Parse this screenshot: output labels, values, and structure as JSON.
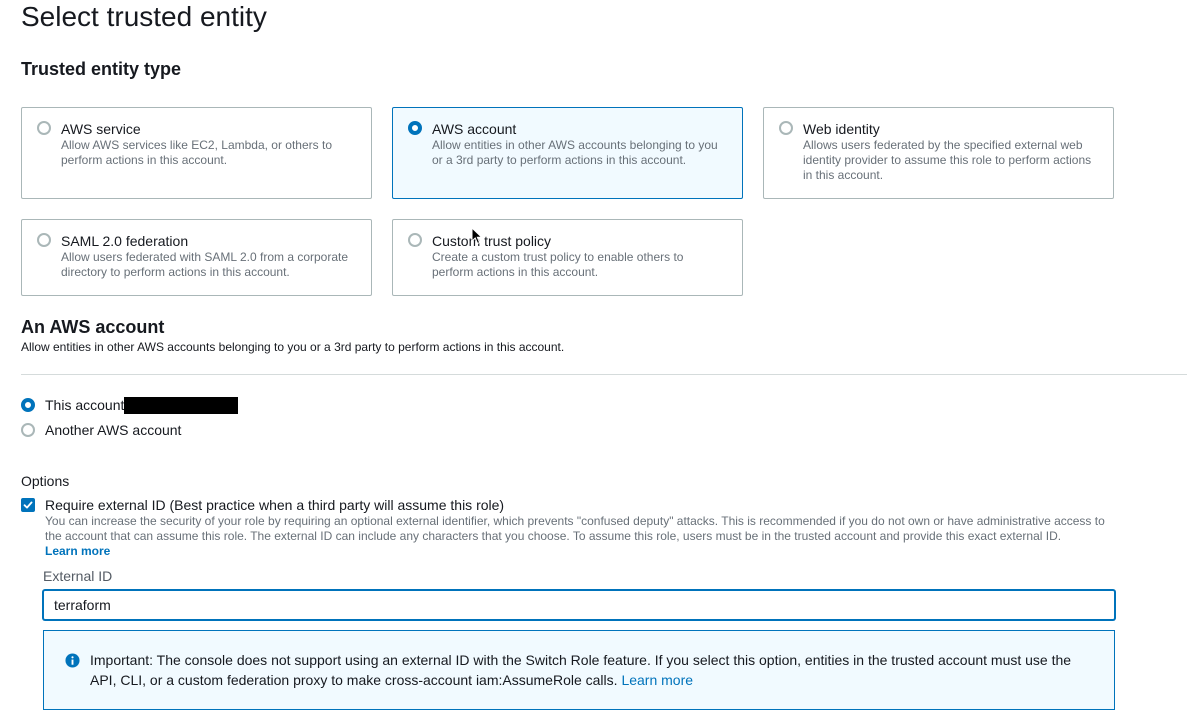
{
  "page": {
    "title": "Select trusted entity"
  },
  "trusted_entity_type": {
    "heading": "Trusted entity type",
    "options": [
      {
        "label": "AWS service",
        "description": "Allow AWS services like EC2, Lambda, or others to perform actions in this account.",
        "selected": false
      },
      {
        "label": "AWS account",
        "description": "Allow entities in other AWS accounts belonging to you or a 3rd party to perform actions in this account.",
        "selected": true
      },
      {
        "label": "Web identity",
        "description": "Allows users federated by the specified external web identity provider to assume this role to perform actions in this account.",
        "selected": false
      },
      {
        "label": "SAML 2.0 federation",
        "description": "Allow users federated with SAML 2.0 from a corporate directory to perform actions in this account.",
        "selected": false
      },
      {
        "label": "Custom trust policy",
        "description": "Create a custom trust policy to enable others to perform actions in this account.",
        "selected": false
      }
    ]
  },
  "aws_account": {
    "heading": "An AWS account",
    "description": "Allow entities in other AWS accounts belonging to you or a 3rd party to perform actions in this account.",
    "choices": [
      {
        "label": "This account",
        "selected": true
      },
      {
        "label": "Another AWS account",
        "selected": false
      }
    ]
  },
  "options": {
    "label": "Options",
    "require_external_id": {
      "label": "Require external ID (Best practice when a third party will assume this role)",
      "checked": true,
      "description": "You can increase the security of your role by requiring an optional external identifier, which prevents \"confused deputy\" attacks. This is recommended if you do not own or have administrative access to the account that can assume this role. The external ID can include any characters that you choose. To assume this role, users must be in the trusted account and provide this exact external ID.",
      "learn_more": "Learn more"
    },
    "external_id": {
      "label": "External ID",
      "value": "terraform"
    },
    "alert": {
      "text": "Important: The console does not support using an external ID with the Switch Role feature. If you select this option, entities in the trusted account must use the API, CLI, or a custom federation proxy to make cross-account iam:AssumeRole calls.",
      "learn_more": "Learn more"
    }
  },
  "colors": {
    "accent": "#0073bb",
    "selected_bg": "#f1faff",
    "border": "#aab7b8",
    "muted_text": "#687078"
  },
  "icons": {
    "alert": "info-circle-icon",
    "checkbox": "checkmark-icon",
    "pointer": "mouse-cursor-icon"
  }
}
